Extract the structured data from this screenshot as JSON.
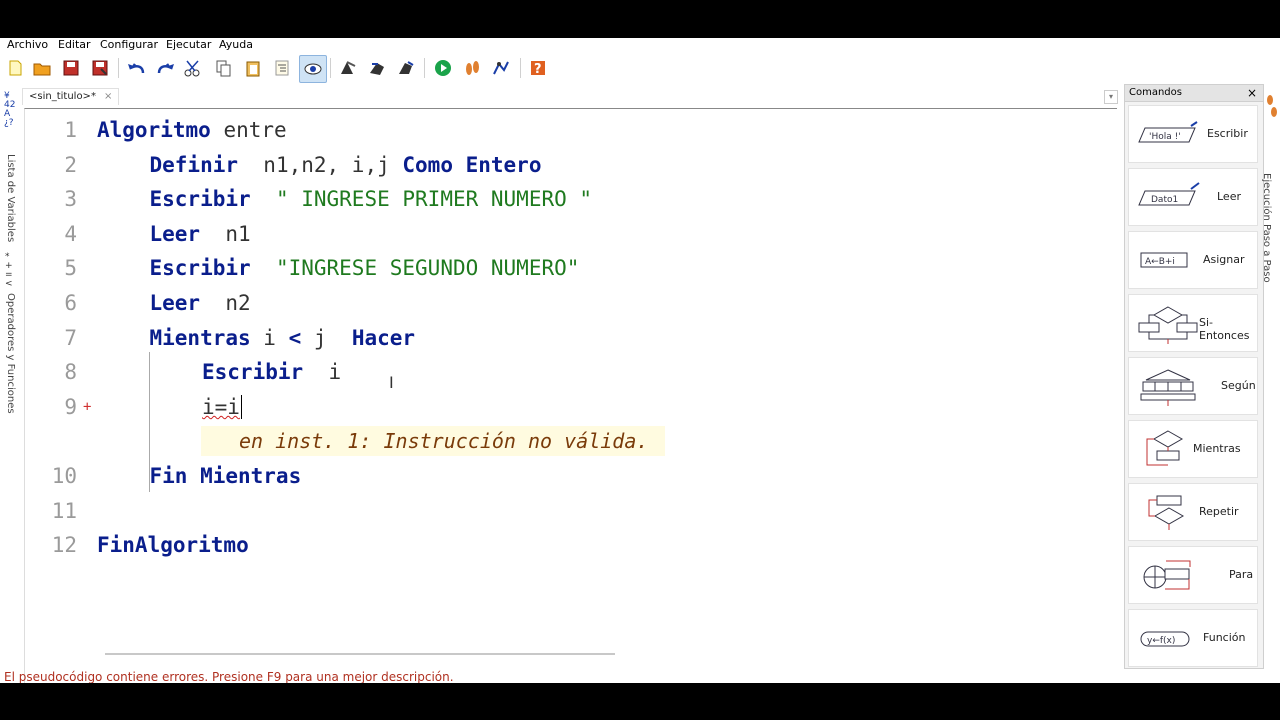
{
  "menu": [
    "Archivo",
    "Editar",
    "Configurar",
    "Ejecutar",
    "Ayuda"
  ],
  "tab": {
    "title": "<sin_titulo>*",
    "close": "×"
  },
  "left_panels": [
    "Lista de Variables",
    "Operadores y Funciones"
  ],
  "right_vertical": "Ejecución Paso a Paso",
  "code": [
    {
      "n": "1",
      "indent": 0,
      "tokens": [
        [
          "kw",
          "Algoritmo"
        ],
        [
          "id",
          " entre"
        ]
      ]
    },
    {
      "n": "2",
      "indent": 1,
      "tokens": [
        [
          "kw",
          "Definir"
        ],
        [
          "id",
          "  n1,n2, i,j "
        ],
        [
          "kw",
          "Como Entero"
        ]
      ]
    },
    {
      "n": "3",
      "indent": 1,
      "tokens": [
        [
          "kw",
          "Escribir"
        ],
        [
          "id",
          "  "
        ],
        [
          "str",
          "\" INGRESE PRIMER NUMERO \""
        ]
      ]
    },
    {
      "n": "4",
      "indent": 1,
      "tokens": [
        [
          "kw",
          "Leer"
        ],
        [
          "id",
          "  n1"
        ]
      ]
    },
    {
      "n": "5",
      "indent": 1,
      "tokens": [
        [
          "kw",
          "Escribir"
        ],
        [
          "id",
          "  "
        ],
        [
          "str",
          "\"INGRESE SEGUNDO NUMERO\""
        ]
      ]
    },
    {
      "n": "6",
      "indent": 1,
      "tokens": [
        [
          "kw",
          "Leer"
        ],
        [
          "id",
          "  n2"
        ]
      ]
    },
    {
      "n": "7",
      "indent": 1,
      "tokens": [
        [
          "kw",
          "Mientras"
        ],
        [
          "id",
          " i "
        ],
        [
          "kw",
          "<"
        ],
        [
          "id",
          " j  "
        ],
        [
          "kw",
          "Hacer"
        ]
      ]
    },
    {
      "n": "8",
      "indent": 2,
      "tokens": [
        [
          "kw",
          "Escribir"
        ],
        [
          "id",
          "  i"
        ]
      ]
    },
    {
      "n": "9",
      "indent": 2,
      "marker": "+",
      "tokens": [
        [
          "err",
          "i=i"
        ]
      ]
    },
    {
      "n": "",
      "error": "en inst. 1: Instrucción no válida."
    },
    {
      "n": "10",
      "indent": 1,
      "tokens": [
        [
          "kw",
          "Fin Mientras"
        ]
      ]
    },
    {
      "n": "11",
      "indent": 0,
      "tokens": []
    },
    {
      "n": "12",
      "indent": 0,
      "tokens": [
        [
          "kw",
          "FinAlgoritmo"
        ]
      ]
    }
  ],
  "status": "El pseudocódigo contiene errores. Presione F9 para una mejor descripción.",
  "commands_panel": {
    "title": "Comandos",
    "close": "×",
    "items": [
      {
        "label": "Escribir",
        "icon": "escribir-icon",
        "icon_text": "'Hola !'"
      },
      {
        "label": "Leer",
        "icon": "leer-icon",
        "icon_text": "Dato1"
      },
      {
        "label": "Asignar",
        "icon": "asignar-icon",
        "icon_text": "A←B+i"
      },
      {
        "label": "Si-Entonces",
        "icon": "si-entonces-icon"
      },
      {
        "label": "Según",
        "icon": "segun-icon"
      },
      {
        "label": "Mientras",
        "icon": "mientras-icon"
      },
      {
        "label": "Repetir",
        "icon": "repetir-icon"
      },
      {
        "label": "Para",
        "icon": "para-icon"
      },
      {
        "label": "Función",
        "icon": "funcion-icon",
        "icon_text": "y←f(x)"
      }
    ]
  },
  "colors": {
    "keyword": "#0a1e8c",
    "string": "#1f7a1f",
    "error_text": "#7a3b0a",
    "status_error": "#b03020"
  }
}
